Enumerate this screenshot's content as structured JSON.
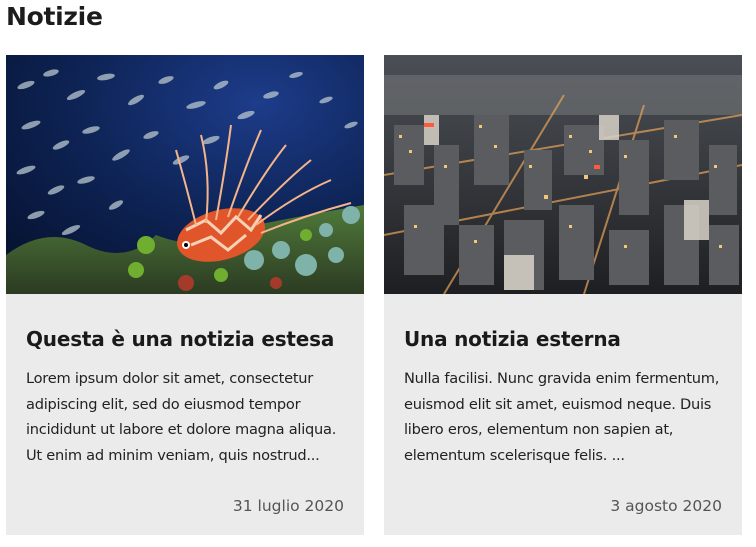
{
  "section": {
    "title": "Notizie"
  },
  "cards": [
    {
      "image": "lionfish-reef-photo",
      "title": "Questa è una notizia estesa",
      "text": "Lorem ipsum dolor sit amet, consectetur adipiscing elit, sed do eiusmod tempor incididunt ut labore et dolore magna aliqua. Ut enim ad minim veniam, quis nostrud...",
      "date": "31 luglio 2020"
    },
    {
      "image": "aerial-city-night-photo",
      "title": "Una notizia esterna",
      "text": "Nulla facilisi. Nunc gravida enim fermentum, euismod elit sit amet, euismod neque. Duis libero eros, elementum non sapien at, elementum scelerisque felis. ...",
      "date": "3 agosto 2020"
    }
  ]
}
